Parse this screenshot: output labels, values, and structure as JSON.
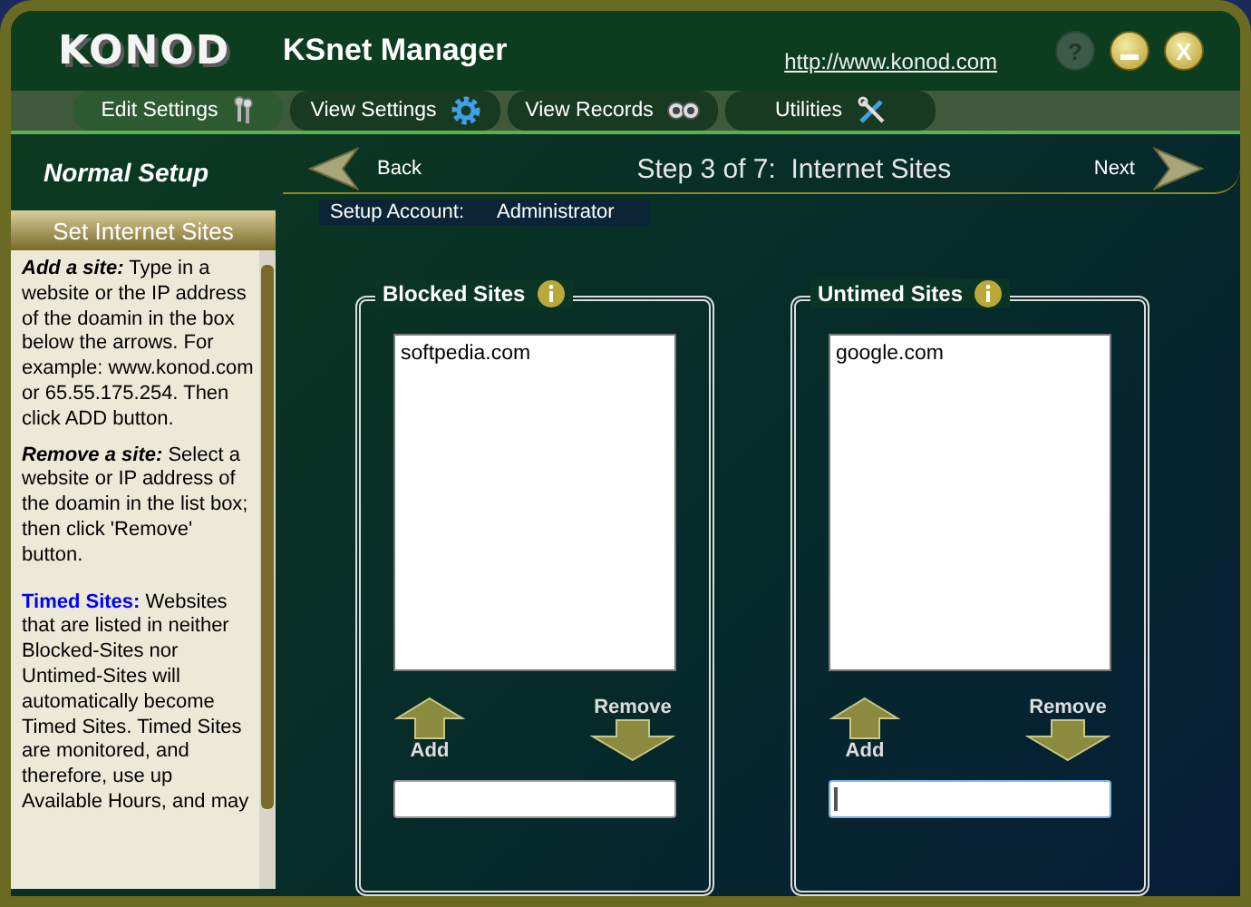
{
  "window": {
    "logo": "KONOD",
    "title": "KSnet Manager",
    "url": "http://www.konod.com",
    "controls": [
      {
        "kind": "help",
        "glyph": "?",
        "disabled": true
      },
      {
        "kind": "minimize",
        "disabled": false
      },
      {
        "kind": "close",
        "glyph": "X",
        "disabled": false
      }
    ]
  },
  "nav": [
    {
      "label": "Edit Settings",
      "selected": true
    },
    {
      "label": "View Settings",
      "selected": false
    },
    {
      "label": "View Records",
      "selected": false
    },
    {
      "label": "Utilities",
      "selected": false
    }
  ],
  "sidebar": {
    "title": "Normal Setup",
    "section": "Set Internet Sites",
    "help": [
      {
        "kind": "term",
        "lead": "Add a site:",
        "text": " Type in a website or the IP address of the doamin in the box below the arrows. For example: www.konod.com or 65.55.175.254. Then click ADD button."
      },
      {
        "kind": "term",
        "lead": "Remove a site:",
        "text": " Select a website or IP address of the doamin in the list box; then click 'Remove' button."
      },
      {
        "kind": "link",
        "lead": "Timed Sites:",
        "text": " Websites that are listed in neither Blocked-Sites nor Untimed-Sites will automatically become Timed Sites. Timed Sites are monitored, and therefore, use up Available Hours, and may"
      }
    ]
  },
  "wizard": {
    "back": "Back",
    "step": "Step 3 of 7:  Internet Sites",
    "next": "Next",
    "account_label": "Setup Account:",
    "account": "Administrator"
  },
  "panels": [
    {
      "title": "Blocked Sites",
      "items": [
        "softpedia.com"
      ],
      "add": "Add",
      "remove": "Remove",
      "focused": false
    },
    {
      "title": "Untimed Sites",
      "items": [
        "google.com"
      ],
      "add": "Add",
      "remove": "Remove",
      "focused": true
    }
  ]
}
